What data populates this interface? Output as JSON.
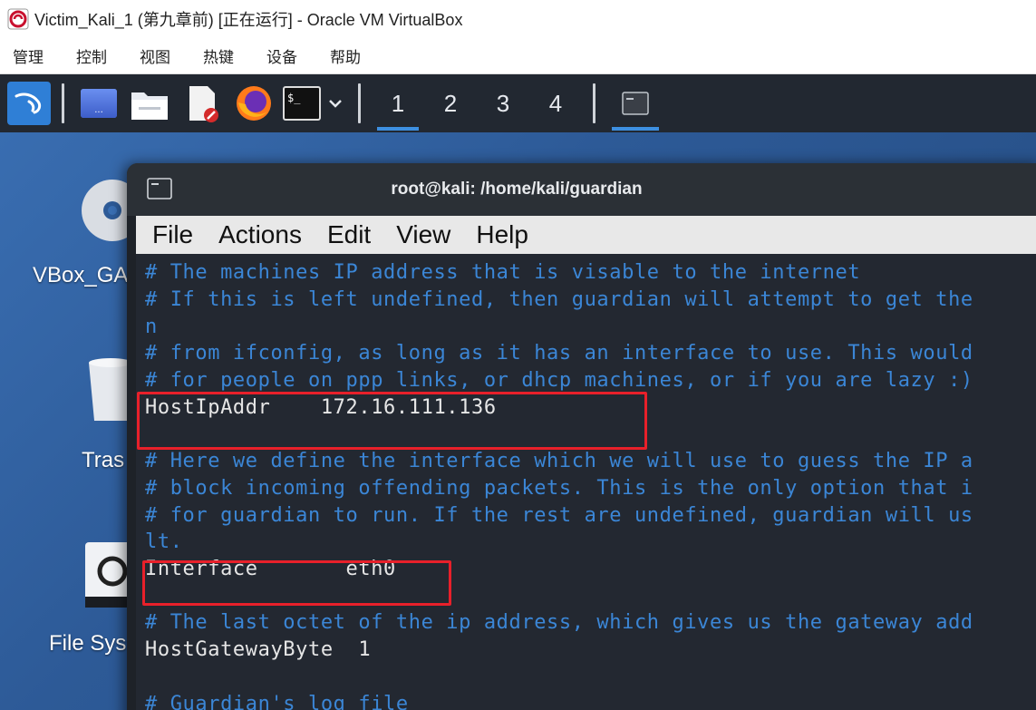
{
  "host": {
    "title": "Victim_Kali_1 (第九章前) [正在运行] - Oracle VM VirtualBox",
    "menu": [
      "管理",
      "控制",
      "视图",
      "热键",
      "设备",
      "帮助"
    ]
  },
  "panel": {
    "workspaces": [
      "1",
      "2",
      "3",
      "4"
    ],
    "active_workspace": "1"
  },
  "desktop_icons": {
    "vbox": "VBox_GA",
    "trash": "Tras",
    "filesystem": "File Sys"
  },
  "terminal": {
    "title": "root@kali: /home/kali/guardian",
    "menu": [
      "File",
      "Actions",
      "Edit",
      "View",
      "Help"
    ],
    "lines": [
      "# The machines IP address that is visable to the internet",
      "# If this is left undefined, then guardian will attempt to get the",
      "n",
      "# from ifconfig, as long as it has an interface to use. This would",
      "# for people on ppp links, or dhcp machines, or if you are lazy :)",
      "HostIpAddr    172.16.111.136",
      "",
      "# Here we define the interface which we will use to guess the IP a",
      "# block incoming offending packets. This is the only option that i",
      "# for guardian to run. If the rest are undefined, guardian will us",
      "lt.",
      "Interface       eth0",
      "",
      "# The last octet of the ip address, which gives us the gateway add",
      "HostGatewayByte  1",
      "",
      "# Guardian's log file"
    ]
  },
  "colors": {
    "comment": "#3b86d6",
    "highlight": "#e8202a",
    "panel": "#222831"
  }
}
